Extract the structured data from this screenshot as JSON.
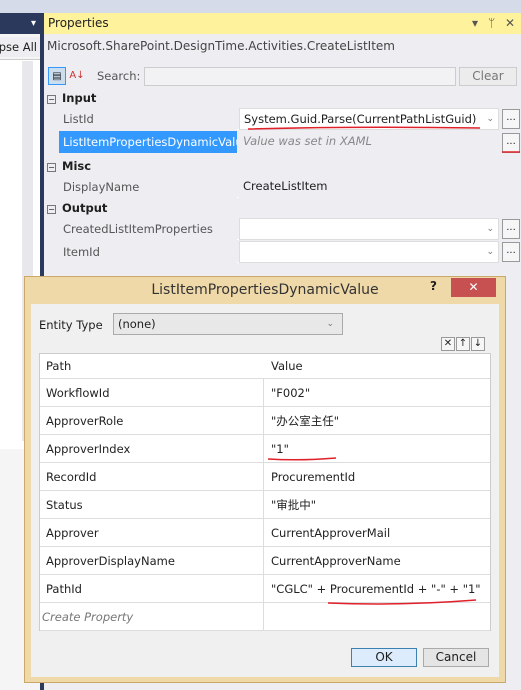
{
  "left_panel": {
    "collapse_label": "Collapse All",
    "menu_icon": "▾"
  },
  "properties": {
    "title": "Properties",
    "title_controls": [
      "▾",
      "ᛘ",
      "✕"
    ],
    "type_name": "Microsoft.SharePoint.DesignTime.Activities.CreateListItem",
    "search_label": "Search:",
    "search_value": "",
    "clear_label": "Clear",
    "categories": [
      {
        "name": "Input",
        "rows": [
          {
            "name": "ListId",
            "value": "System.Guid.Parse(CurrentPathListGuid)",
            "dropdown": true,
            "ellipsis": "..."
          },
          {
            "name": "ListItemPropertiesDynamicValue",
            "value": "Value was set in XAML",
            "selected": true,
            "ellipsis": "..."
          }
        ]
      },
      {
        "name": "Misc",
        "rows": [
          {
            "name": "DisplayName",
            "value": "CreateListItem"
          }
        ]
      },
      {
        "name": "Output",
        "rows": [
          {
            "name": "CreatedListItemProperties",
            "value": "",
            "dropdown": true,
            "ellipsis": "..."
          },
          {
            "name": "ItemId",
            "value": "",
            "dropdown": true,
            "ellipsis": "..."
          }
        ]
      }
    ]
  },
  "dialog": {
    "title": "ListItemPropertiesDynamicValue",
    "help": "?",
    "close": "✕",
    "entity_type_label": "Entity Type",
    "entity_type_value": "(none)",
    "grid_buttons": [
      "✕",
      "↑",
      "↓"
    ],
    "columns": [
      "Path",
      "Value"
    ],
    "rows": [
      [
        "WorkflowId",
        "\"F002\""
      ],
      [
        "ApproverRole",
        "\"办公室主任\""
      ],
      [
        "ApproverIndex",
        "\"1\""
      ],
      [
        "RecordId",
        "ProcurementId"
      ],
      [
        "Status",
        "\"审批中\""
      ],
      [
        "Approver",
        "CurrentApproverMail"
      ],
      [
        "ApproverDisplayName",
        "CurrentApproverName"
      ],
      [
        "PathId",
        "\"CGLC\" + ProcurementId + \"-\" + \"1\""
      ]
    ],
    "create_property": "Create Property",
    "ok": "OK",
    "cancel": "Cancel"
  },
  "colors": {
    "title_yellow": "#fff29d",
    "selected": "#3399ff",
    "dialog_frame": "#f0d9a9",
    "annotation_red": "#e0202a"
  }
}
